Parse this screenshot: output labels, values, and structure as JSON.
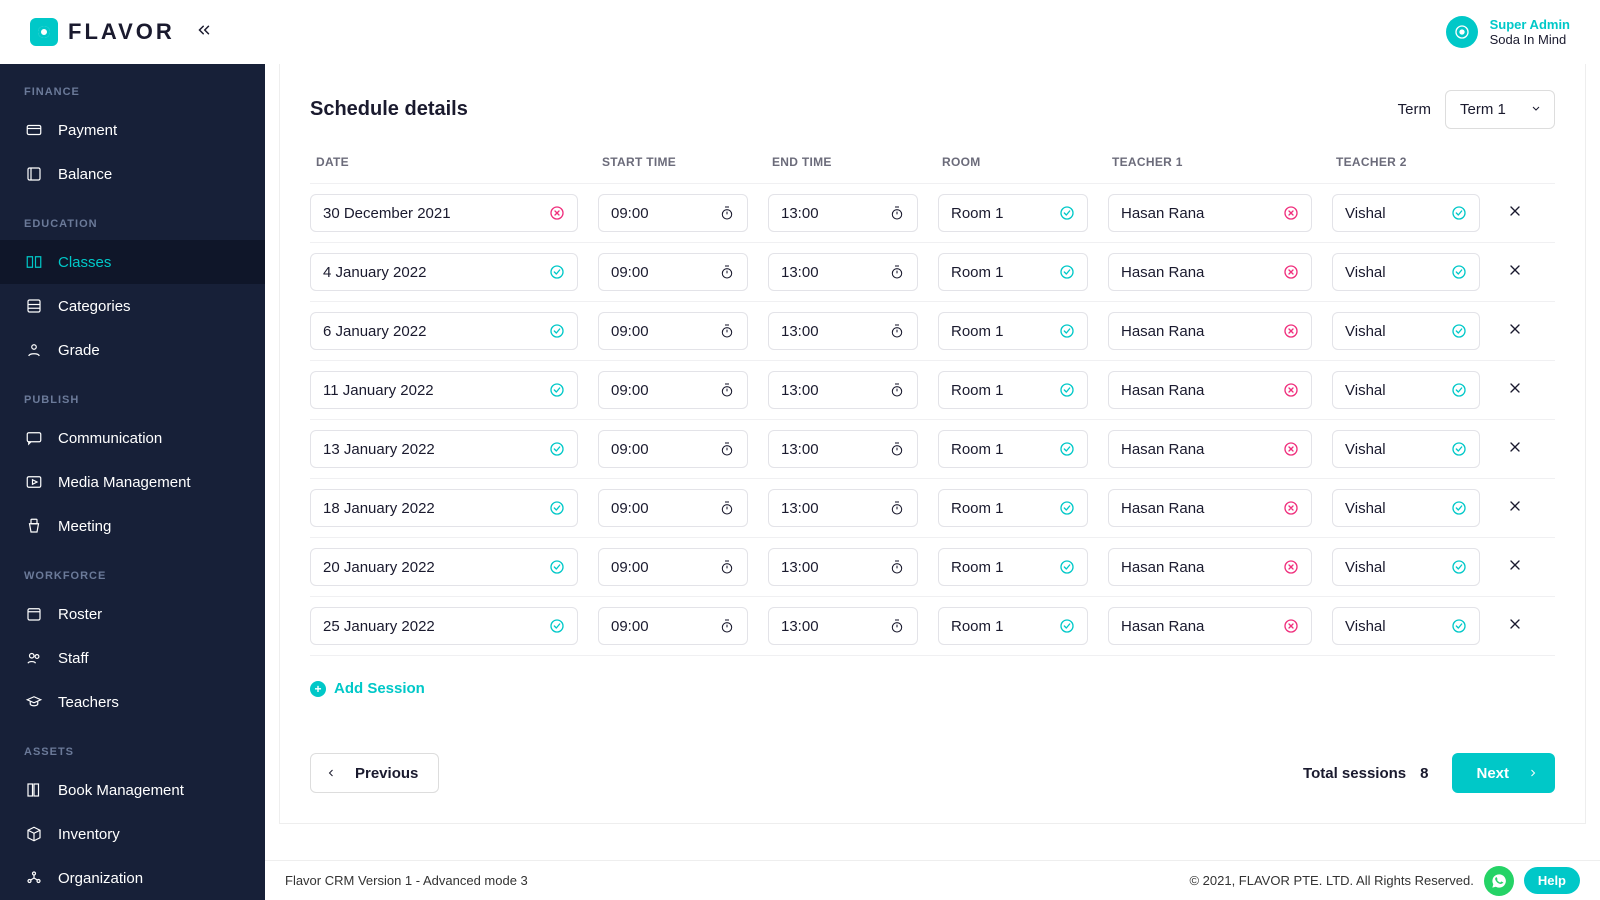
{
  "app": {
    "brand": "FLAVOR"
  },
  "user": {
    "role": "Super Admin",
    "name": "Soda In Mind"
  },
  "sidebar": {
    "sections": [
      {
        "label": "FINANCE",
        "items": [
          {
            "label": "Payment",
            "icon": "card"
          },
          {
            "label": "Balance",
            "icon": "book"
          }
        ]
      },
      {
        "label": "EDUCATION",
        "items": [
          {
            "label": "Classes",
            "icon": "book-open",
            "active": true
          },
          {
            "label": "Categories",
            "icon": "layers"
          },
          {
            "label": "Grade",
            "icon": "grad"
          }
        ]
      },
      {
        "label": "PUBLISH",
        "items": [
          {
            "label": "Communication",
            "icon": "chat"
          },
          {
            "label": "Media Management",
            "icon": "media"
          },
          {
            "label": "Meeting",
            "icon": "podium"
          }
        ]
      },
      {
        "label": "WORKFORCE",
        "items": [
          {
            "label": "Roster",
            "icon": "calendar"
          },
          {
            "label": "Staff",
            "icon": "users"
          },
          {
            "label": "Teachers",
            "icon": "cap"
          }
        ]
      },
      {
        "label": "ASSETS",
        "items": [
          {
            "label": "Book Management",
            "icon": "books"
          },
          {
            "label": "Inventory",
            "icon": "box"
          },
          {
            "label": "Organization",
            "icon": "org"
          }
        ]
      }
    ]
  },
  "schedule": {
    "title": "Schedule details",
    "term_label": "Term",
    "term_value": "Term 1",
    "columns": {
      "date": "DATE",
      "start": "START TIME",
      "end": "END TIME",
      "room": "ROOM",
      "t1": "TEACHER 1",
      "t2": "TEACHER 2"
    },
    "rows": [
      {
        "date": "30 December 2021",
        "date_ok": false,
        "start": "09:00",
        "end": "13:00",
        "room": "Room 1",
        "room_ok": true,
        "t1": "Hasan Rana",
        "t1_ok": false,
        "t2": "Vishal",
        "t2_ok": true
      },
      {
        "date": "4 January 2022",
        "date_ok": true,
        "start": "09:00",
        "end": "13:00",
        "room": "Room 1",
        "room_ok": true,
        "t1": "Hasan Rana",
        "t1_ok": false,
        "t2": "Vishal",
        "t2_ok": true
      },
      {
        "date": "6 January 2022",
        "date_ok": true,
        "start": "09:00",
        "end": "13:00",
        "room": "Room 1",
        "room_ok": true,
        "t1": "Hasan Rana",
        "t1_ok": false,
        "t2": "Vishal",
        "t2_ok": true
      },
      {
        "date": "11 January 2022",
        "date_ok": true,
        "start": "09:00",
        "end": "13:00",
        "room": "Room 1",
        "room_ok": true,
        "t1": "Hasan Rana",
        "t1_ok": false,
        "t2": "Vishal",
        "t2_ok": true
      },
      {
        "date": "13 January 2022",
        "date_ok": true,
        "start": "09:00",
        "end": "13:00",
        "room": "Room 1",
        "room_ok": true,
        "t1": "Hasan Rana",
        "t1_ok": false,
        "t2": "Vishal",
        "t2_ok": true
      },
      {
        "date": "18 January 2022",
        "date_ok": true,
        "start": "09:00",
        "end": "13:00",
        "room": "Room 1",
        "room_ok": true,
        "t1": "Hasan Rana",
        "t1_ok": false,
        "t2": "Vishal",
        "t2_ok": true
      },
      {
        "date": "20 January 2022",
        "date_ok": true,
        "start": "09:00",
        "end": "13:00",
        "room": "Room 1",
        "room_ok": true,
        "t1": "Hasan Rana",
        "t1_ok": false,
        "t2": "Vishal",
        "t2_ok": true
      },
      {
        "date": "25 January 2022",
        "date_ok": true,
        "start": "09:00",
        "end": "13:00",
        "room": "Room 1",
        "room_ok": true,
        "t1": "Hasan Rana",
        "t1_ok": false,
        "t2": "Vishal",
        "t2_ok": true
      }
    ],
    "add_session": "Add Session",
    "prev": "Previous",
    "next": "Next",
    "total_label": "Total sessions",
    "total_value": "8"
  },
  "footer": {
    "left": "Flavor CRM Version 1 - Advanced mode 3",
    "right": "© 2021, FLAVOR PTE. LTD. All Rights Reserved.",
    "help": "Help"
  }
}
